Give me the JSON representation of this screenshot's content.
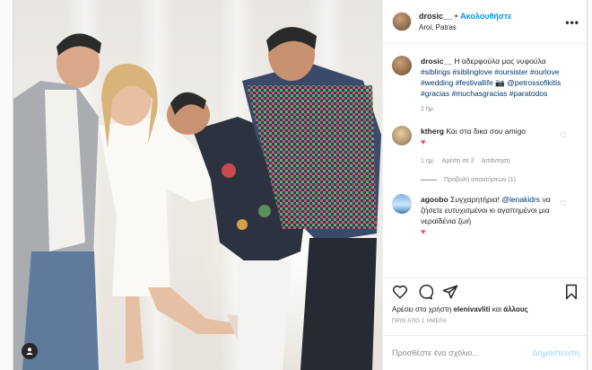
{
  "header": {
    "username": "drosic__",
    "separator": "•",
    "follow_label": "Ακολουθήστε",
    "location": "Aroi, Patras",
    "more_icon": "more-horizontal-icon"
  },
  "caption": {
    "username": "drosic__",
    "text_before": "Η αδερφούλα μας νυφούλα",
    "hashtags": "#siblings #siblinglove #oursister #ourlove #wedding #festivallife",
    "emoji": "📷",
    "mention": "@petrossofikitis",
    "hashtags2": "#gracias #muchasgracias #paratodos",
    "time": "1 ημ."
  },
  "comments": [
    {
      "username": "ktherg",
      "text": "Και στα δικα σου amigo",
      "has_heart": true,
      "time": "1 ημ.",
      "likes": "Αρέσει σε 2",
      "reply": "Απάντηση",
      "view_replies": "Προβολή απαντήσεων (1)"
    },
    {
      "username": "agoobo",
      "text_before": "Συγχαρητήρια!",
      "mention": "@lenakidrs",
      "text_after": "να ζήσετε ευτυχισμένοι κι αγαπημένοι μια νεραϊδένια ζωή",
      "has_heart": true
    }
  ],
  "actions": {
    "like_icon": "heart-outline-icon",
    "comment_icon": "comment-icon",
    "share_icon": "share-icon",
    "save_icon": "bookmark-icon"
  },
  "likes": {
    "prefix": "Αρέσει στο χρήστη",
    "user": "elenivavliti",
    "and": "και",
    "others": "άλλους"
  },
  "timestamp": "ΠΡΙΝ ΑΠΟ 1 ΗΜΕΡΑ",
  "add_comment": {
    "placeholder": "Προσθέστε ένα σχόλιο...",
    "post_label": "Δημοσίευση"
  },
  "colors": {
    "link_blue": "#0095f6",
    "tag_blue": "#00376b",
    "heart_red": "#ed4956",
    "muted": "#8e8e8e"
  }
}
